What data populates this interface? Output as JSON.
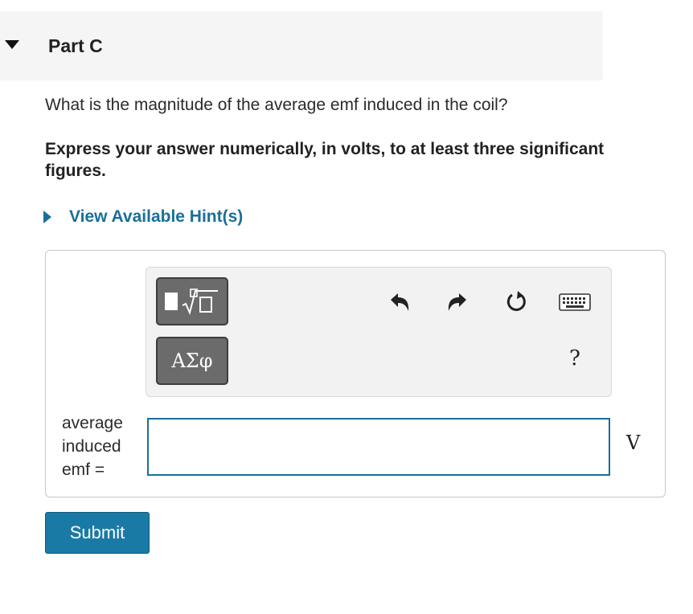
{
  "part": {
    "title": "Part C"
  },
  "question": {
    "text": "What is the magnitude of the average emf induced in the coil?",
    "instruction": "Express your answer numerically, in volts, to at least three significant figures."
  },
  "hint": {
    "label": "View Available Hint(s)"
  },
  "toolbar": {
    "templates_icon": "templates-icon",
    "symbols_label": "ΑΣφ",
    "undo_icon": "undo-icon",
    "redo_icon": "redo-icon",
    "reset_icon": "reset-icon",
    "keyboard_icon": "keyboard-icon",
    "help_label": "?"
  },
  "answer": {
    "label": "average induced emf =",
    "value": "",
    "placeholder": "",
    "unit": "V"
  },
  "submit": {
    "label": "Submit"
  },
  "colors": {
    "accent": "#1a6f99",
    "button": "#1a7aa6",
    "toolbar_button": "#6b6b6b",
    "header_bg": "#f5f5f5"
  }
}
